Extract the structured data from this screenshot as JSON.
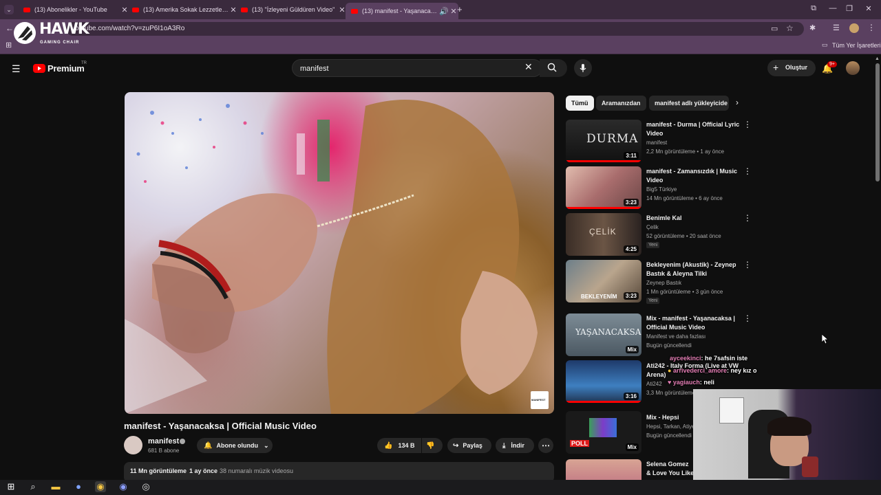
{
  "browser": {
    "tabs": [
      {
        "label": "(13) Abonelikler - YouTube"
      },
      {
        "label": "(13) Amerika Sokak Lezzetleri |"
      },
      {
        "label": "(13) \"İzleyeni Güldüren Video\""
      },
      {
        "label": "(13) manifest - Yaşanacaksa"
      }
    ],
    "url": "youtube.com/watch?v=zuP6I1oA3Ro",
    "bookmarks_all": "Tüm Yer İşaretleri"
  },
  "overlay": {
    "brand": "HAWK",
    "brand_sub": "GAMING CHAIR"
  },
  "youtube": {
    "logo": "Premium",
    "logo_region": "TR",
    "search_value": "manifest",
    "create_label": "Oluştur",
    "notif_count": "9+"
  },
  "video": {
    "title": "manifest - Yaşanacaksa | Official Music Video",
    "watermark": "MANIFEST",
    "channel": "manifest",
    "subscribers": "681 B abone",
    "subscribe_label": "Abone olundu",
    "likes": "134 B",
    "share_label": "Paylaş",
    "download_label": "İndir",
    "views": "11 Mn görüntüleme",
    "age": "1 ay önce",
    "tag": "38 numaralı müzik videosu"
  },
  "chips": [
    "Tümü",
    "Aramanızdan",
    "manifest adlı yükleyicide"
  ],
  "related": [
    {
      "title": "manifest - Durma | Official Lyric Video",
      "channel": "manifest",
      "meta": "2,2 Mn görüntüleme • 1 ay önce",
      "duration": "3:11",
      "thumb_text": "DURMA",
      "badge": ""
    },
    {
      "title": "manifest - Zamansızdık | Music Video",
      "channel": "Big5 Türkiye",
      "meta": "14 Mn görüntüleme • 6 ay önce",
      "duration": "3:23",
      "thumb_text": "",
      "badge": ""
    },
    {
      "title": "Benimle Kal",
      "channel": "Çelik",
      "meta": "52 görüntüleme • 20 saat önce",
      "duration": "4:25",
      "thumb_text": "ÇELİK",
      "badge": "Yeni"
    },
    {
      "title": "Bekleyenim (Akustik) - Zeynep Bastık & Aleyna Tilki",
      "channel": "Zeynep Bastık",
      "meta": "1 Mn görüntüleme • 3 gün önce",
      "duration": "3:23",
      "thumb_text": "BEKLEYENİM",
      "badge": "Yeni"
    },
    {
      "title": "Mix - manifest - Yaşanacaksa | Official Music Video",
      "channel": "Manifest ve daha fazlası",
      "meta": "Bugün güncellendi",
      "duration": "Mix",
      "thumb_text": "YAŞANACAKSA",
      "badge": ""
    },
    {
      "title": "Ati242 - Italy Forma (Live at VW Arena)",
      "channel": "Ati242",
      "meta": "3,3 Mn görüntüleme",
      "duration": "3:16",
      "thumb_text": "",
      "badge": ""
    },
    {
      "title": "Mix - Hepsi",
      "channel": "Hepsi, Tarkan, Atiye",
      "meta": "Bugün güncellendi",
      "duration": "Mix",
      "thumb_text": "POLL",
      "badge": ""
    },
    {
      "title": "Selena Gomez & Love You Like A",
      "channel": "",
      "meta": "",
      "duration": "",
      "thumb_text": "",
      "badge": ""
    }
  ],
  "chat": [
    {
      "user": "ayceekinci",
      "msg": ": he 7safsin iste"
    },
    {
      "user": "arrivederci_amore",
      "msg": ": ney kız o"
    },
    {
      "user": "yagiauch",
      "msg": ": neli"
    }
  ]
}
